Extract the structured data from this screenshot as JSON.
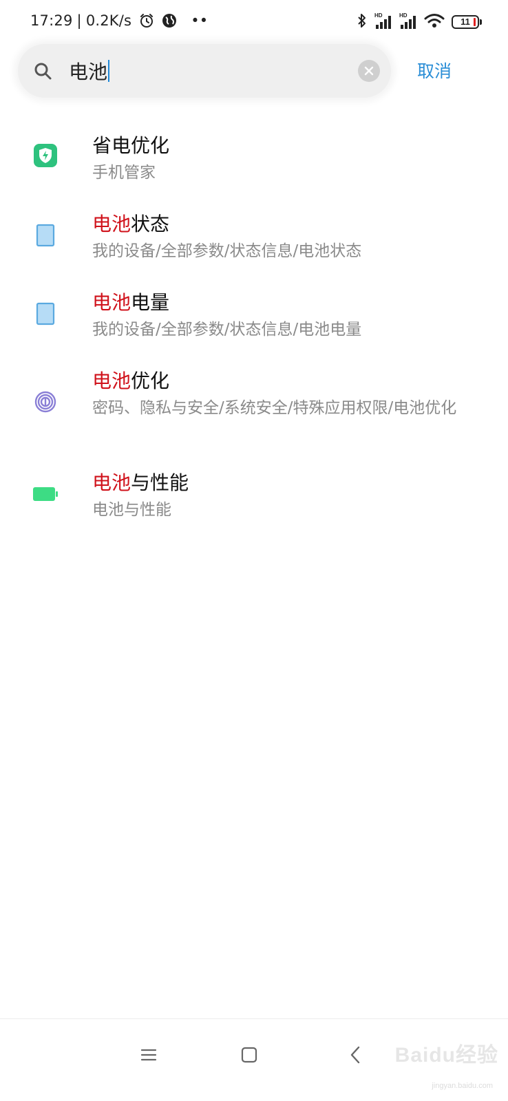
{
  "status_bar": {
    "time": "17:29",
    "separator": "|",
    "network_speed": "0.2K/s",
    "more_indicator": "••",
    "signal_label": "HD",
    "battery_level": "11",
    "icons": [
      "alarm-icon",
      "globe-icon",
      "bluetooth-icon",
      "signal-icon",
      "wifi-icon",
      "battery-icon"
    ]
  },
  "search": {
    "query": "电池",
    "cancel_label": "取消"
  },
  "results": [
    {
      "icon": "shield-bolt-icon",
      "icon_color": "#2ec27e",
      "title_highlight": "",
      "title_rest": "省电优化",
      "path": "手机管家"
    },
    {
      "icon": "device-icon",
      "icon_color": "#7ec4f0",
      "title_highlight": "电池",
      "title_rest": "状态",
      "path": "我的设备/全部参数/状态信息/电池状态"
    },
    {
      "icon": "device-icon",
      "icon_color": "#7ec4f0",
      "title_highlight": "电池",
      "title_rest": "电量",
      "path": "我的设备/全部参数/状态信息/电池电量"
    },
    {
      "icon": "fingerprint-icon",
      "icon_color": "#8a7fd6",
      "title_highlight": "电池",
      "title_rest": "优化",
      "path": "密码、隐私与安全/系统安全/特殊应用权限/电池优化"
    },
    {
      "icon": "battery-icon",
      "icon_color": "#3ddc84",
      "title_highlight": "电池",
      "title_rest": "与性能",
      "path": "电池与性能"
    }
  ],
  "nav_bar": {
    "buttons": [
      "menu-icon",
      "home-icon",
      "back-icon"
    ]
  },
  "watermark": {
    "brand": "Baidu经验",
    "url": "jingyan.baidu.com"
  },
  "colors": {
    "accent": "#2b8ed6",
    "highlight": "#d0121b",
    "secondary_text": "#8a8a8a"
  }
}
